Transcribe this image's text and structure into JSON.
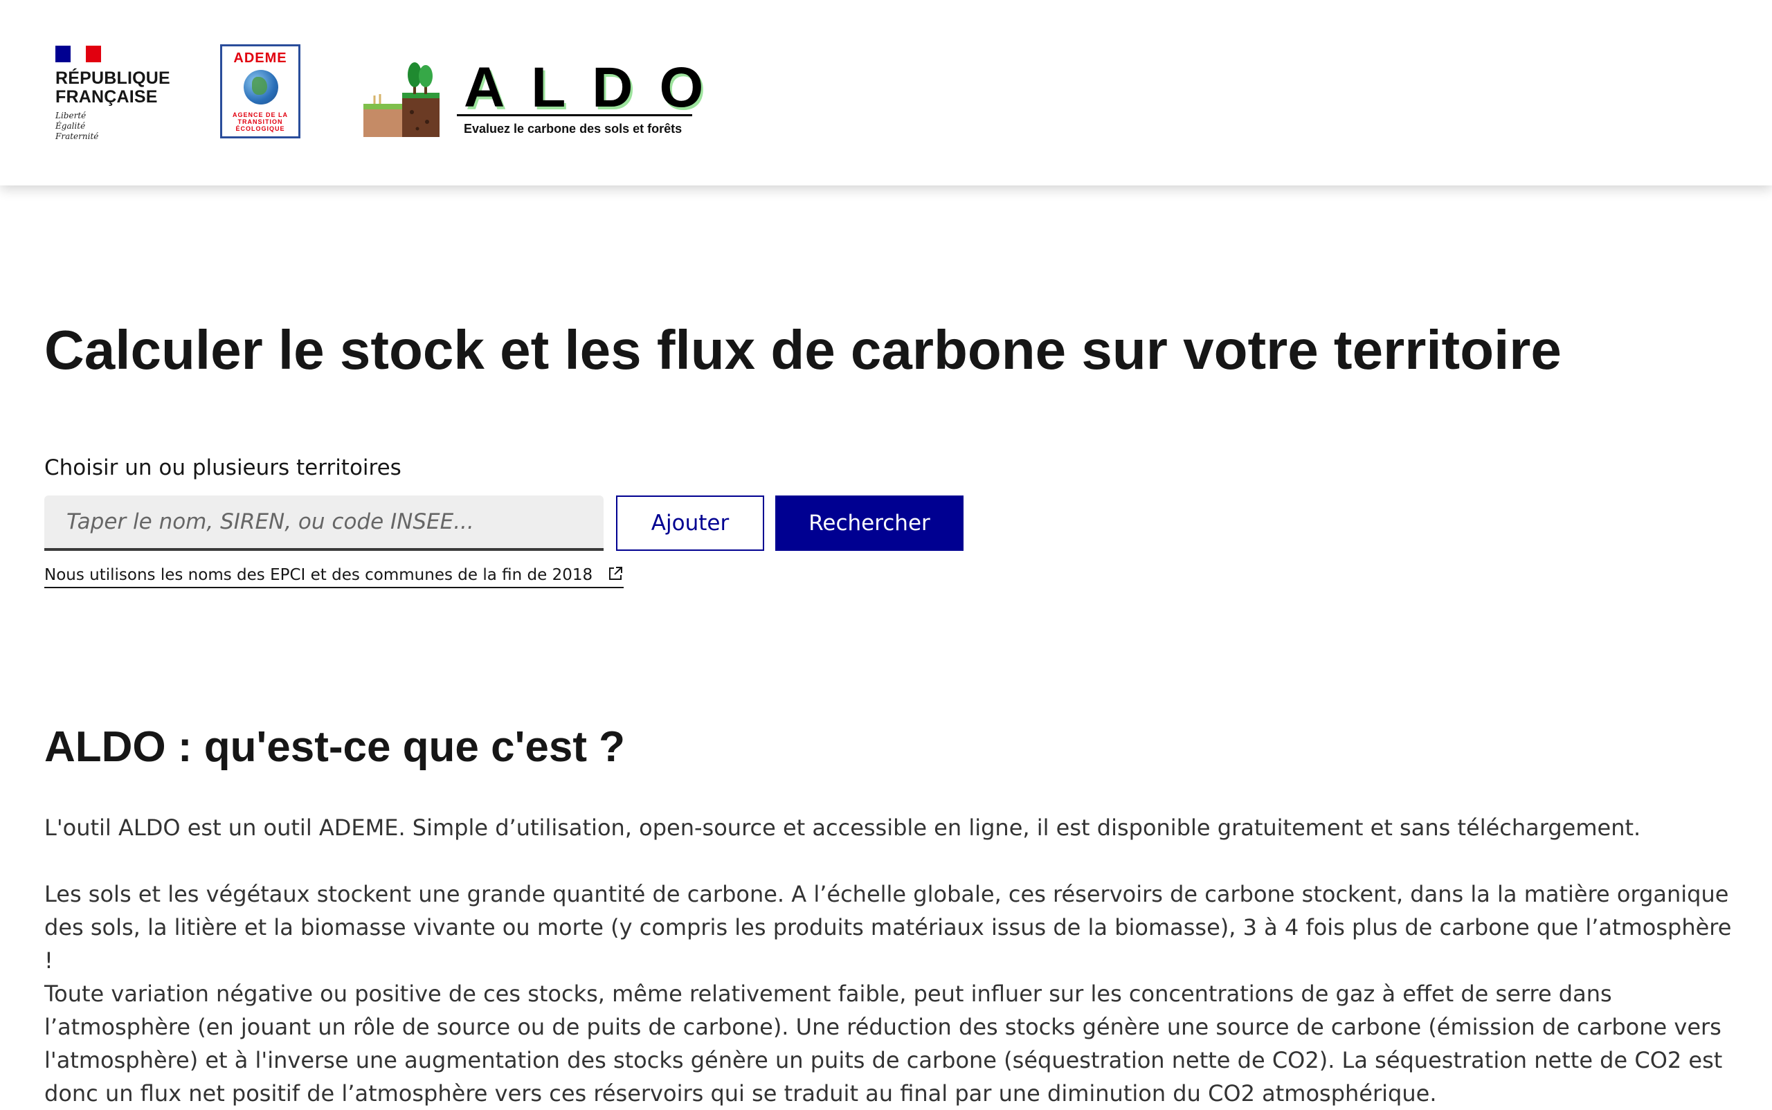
{
  "header": {
    "republique": {
      "name_line1": "RÉPUBLIQUE",
      "name_line2": "FRANÇAISE",
      "motto_line1": "Liberté",
      "motto_line2": "Égalité",
      "motto_line3": "Fraternité",
      "flag_colors": [
        "#000091",
        "#ffffff",
        "#e1000f"
      ]
    },
    "ademe": {
      "title": "ADEME",
      "subtitle": "AGENCE DE LA TRANSITION ÉCOLOGIQUE",
      "color": "#e1000f"
    },
    "aldo": {
      "name": "ALDO",
      "tagline": "Evaluez le carbone des sols et forêts"
    }
  },
  "main": {
    "title": "Calculer le stock et les flux de carbone sur votre territoire",
    "search": {
      "label": "Choisir un ou plusieurs territoires",
      "placeholder": "Taper le nom, SIREN, ou code INSEE...",
      "value": "",
      "add_label": "Ajouter",
      "search_label": "Rechercher",
      "note_link": "Nous utilisons les noms des EPCI et des communes de la fin de 2018",
      "note_icon": "external-link-icon"
    }
  },
  "about": {
    "title": "ALDO : qu'est-ce que c'est ?",
    "paragraphs": [
      "L'outil ALDO est un outil ADEME. Simple d’utilisation, open-source et accessible en ligne, il est disponible gratuitement et sans téléchargement.",
      "Les sols et les végétaux stockent une grande quantité de carbone. A l’échelle globale, ces réservoirs de carbone stockent, dans la la matière organique des sols, la litière et la biomasse vivante ou morte (y compris les produits matériaux issus de la biomasse), 3 à 4 fois plus de carbone que l’atmosphère !",
      "Toute variation négative ou positive de ces stocks, même relativement faible, peut influer sur les concentrations de gaz à effet de serre dans l’atmosphère (en jouant un rôle de source ou de puits de carbone). Une réduction des stocks génère une source de carbone (émission de carbone vers l'atmosphère) et à l'inverse une augmentation des stocks génère un puits de carbone (séquestration nette de CO2). La séquestration nette de CO2 est donc un flux net positif de l’atmosphère vers ces réservoirs qui se traduit au final par une diminution du CO2 atmosphérique."
    ]
  },
  "colors": {
    "primary": "#000091",
    "text": "#161616",
    "input_bg": "#eeeeee"
  }
}
